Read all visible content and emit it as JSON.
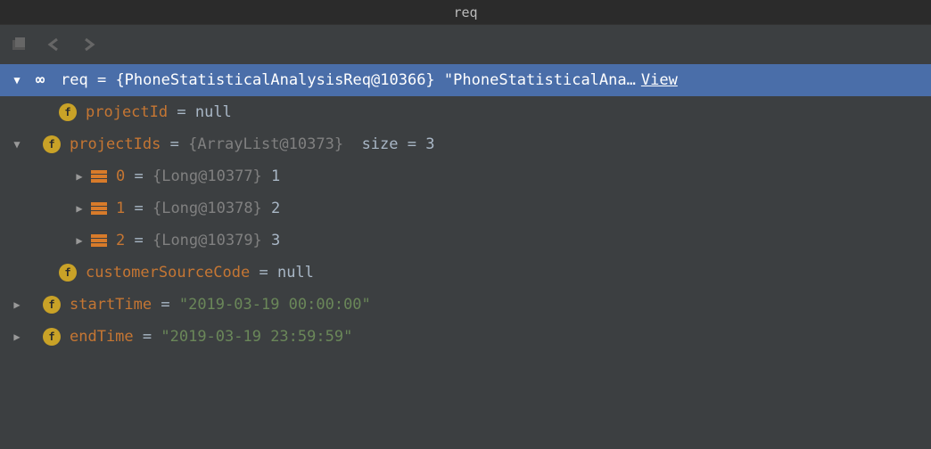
{
  "title": "req",
  "root": {
    "name": "req",
    "objref": "{PhoneStatisticalAnalysisReq@10366}",
    "summary": "\"PhoneStatisticalAna…",
    "view_label": "View"
  },
  "fields": {
    "projectId": {
      "name": "projectId",
      "value": "null"
    },
    "projectIds": {
      "name": "projectIds",
      "objref": "{ArrayList@10373}",
      "size_label": "size = 3"
    },
    "list": [
      {
        "index": "0",
        "objref": "{Long@10377}",
        "value": "1"
      },
      {
        "index": "1",
        "objref": "{Long@10378}",
        "value": "2"
      },
      {
        "index": "2",
        "objref": "{Long@10379}",
        "value": "3"
      }
    ],
    "customerSourceCode": {
      "name": "customerSourceCode",
      "value": "null"
    },
    "startTime": {
      "name": "startTime",
      "value": "\"2019-03-19 00:00:00\""
    },
    "endTime": {
      "name": "endTime",
      "value": "\"2019-03-19 23:59:59\""
    }
  },
  "glyphs": {
    "tri_down": "▼",
    "tri_right": "▶",
    "glasses": "∞",
    "field_letter": "f"
  }
}
